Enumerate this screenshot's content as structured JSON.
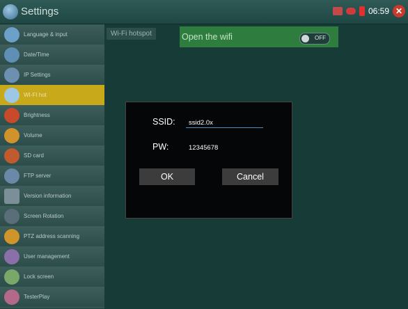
{
  "header": {
    "title": "Settings",
    "time": "06:59"
  },
  "sidebar": {
    "items": [
      {
        "label": "Language & input",
        "color": "#6da0c8"
      },
      {
        "label": "Date/Time",
        "color": "#5f8fb5"
      },
      {
        "label": "IP Settings",
        "color": "#6e90b0"
      },
      {
        "label": "WI-FI hot",
        "color": "#ffffff"
      },
      {
        "label": "Brightness",
        "color": "#c94a2a"
      },
      {
        "label": "Volume",
        "color": "#d0922a"
      },
      {
        "label": "SD card",
        "color": "#c25a2f"
      },
      {
        "label": "FTP server",
        "color": "#6a88a8"
      },
      {
        "label": "Version information",
        "color": "#7b8f99"
      },
      {
        "label": "Screen Rotation",
        "color": "#5a6e7a"
      },
      {
        "label": "PTZ address scanning",
        "color": "#d0952a"
      },
      {
        "label": "User management",
        "color": "#8a6fa8"
      },
      {
        "label": "Lock screen",
        "color": "#7aa86a"
      },
      {
        "label": "TesterPlay",
        "color": "#b36a8a"
      }
    ]
  },
  "main": {
    "section_label": "Wi-Fi hotspot",
    "wifi_label": "Open the wifi",
    "toggle_label": "OFF"
  },
  "dialog": {
    "ssid_label": "SSID:",
    "ssid_value": "ssid2.0x",
    "pw_label": "PW:",
    "pw_value": "12345678",
    "ok_label": "OK",
    "cancel_label": "Cancel"
  }
}
